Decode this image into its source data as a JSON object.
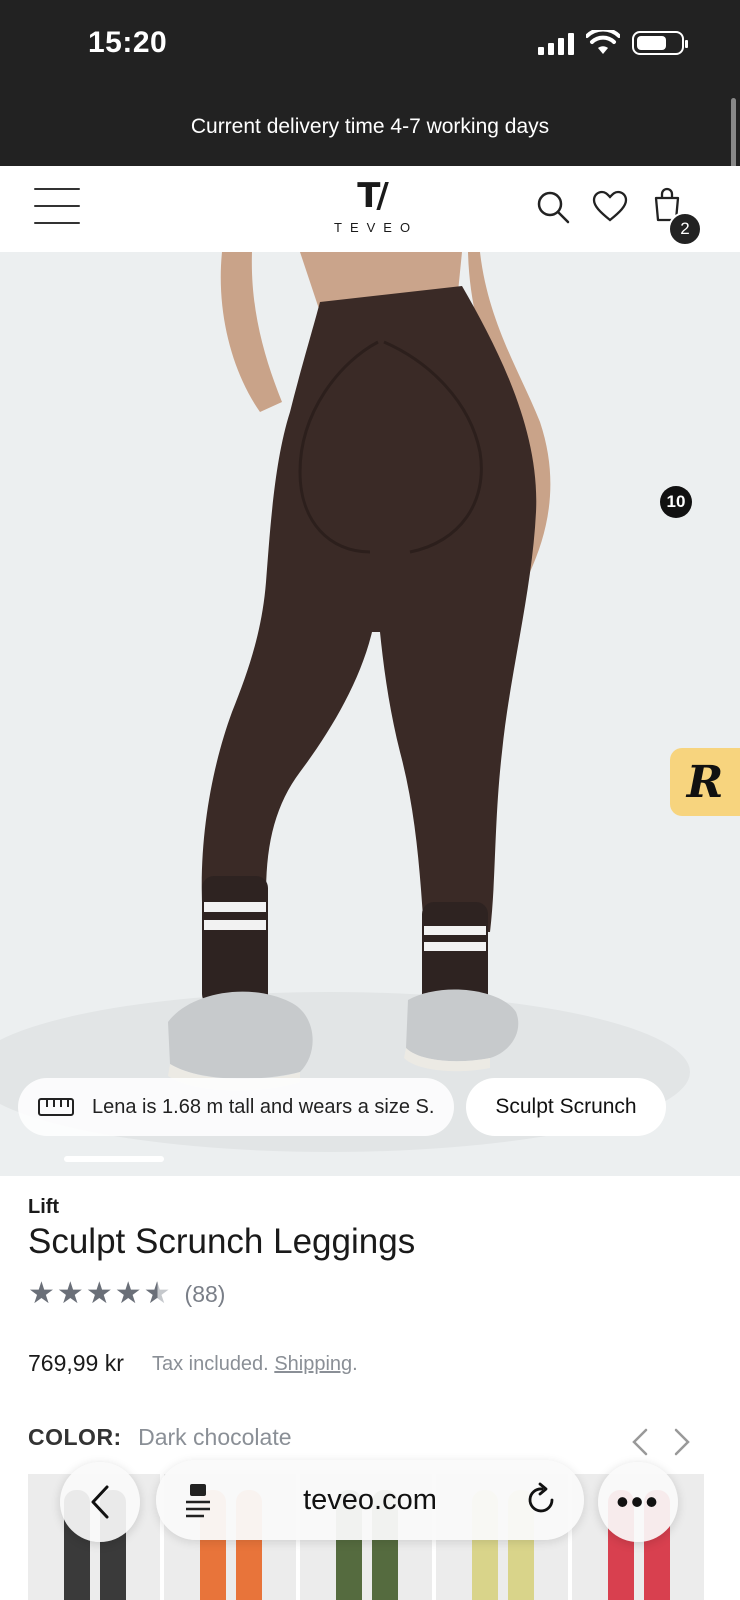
{
  "status_bar": {
    "time": "15:20"
  },
  "announcement": {
    "text": "Current delivery time 4-7 working days"
  },
  "header": {
    "logo_text": "TEVEO",
    "cart_count": "2"
  },
  "hero": {
    "rewards_badge": "10",
    "rewards_label": "R",
    "model_info": "Lena is 1.68 m tall and wears a size S.",
    "style_chip": "Sculpt Scrunch"
  },
  "product": {
    "brand": "Lift",
    "title": "Sculpt Scrunch Leggings",
    "rating": 4.5,
    "rating_count": "(88)",
    "price": "769,99 kr",
    "tax_note": "Tax included.",
    "shipping_link": "Shipping",
    "color_label": "COLOR:",
    "color_value": "Dark chocolate"
  },
  "swatches": [
    {
      "color": "#3a3a3a"
    },
    {
      "color": "#e8743a"
    },
    {
      "color": "#556b3f"
    },
    {
      "color": "#d9d48a"
    },
    {
      "color": "#d8404f"
    }
  ],
  "browser": {
    "url": "teveo.com",
    "more_label": "•••"
  },
  "colors": {
    "dark": "#222222",
    "legging": "#3a2a26",
    "hero_bg": "#eceff0",
    "rewards": "#f7d47e"
  }
}
